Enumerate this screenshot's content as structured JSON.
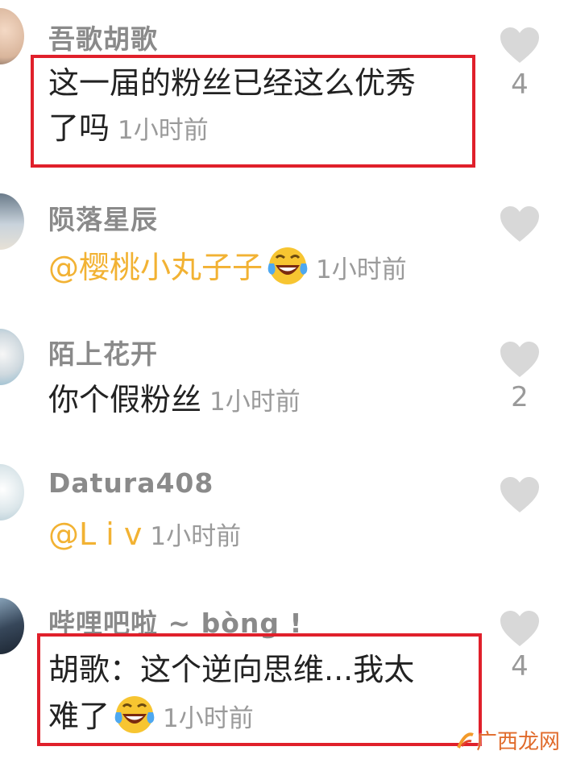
{
  "comments": [
    {
      "username": "吾歌胡歌",
      "lines": [
        "这一届的粉丝已经这么优秀",
        "了吗"
      ],
      "time": "1小时前",
      "likes": "4",
      "highlighted": true
    },
    {
      "username": "陨落星辰",
      "mention": "@樱桃小丸子子",
      "emoji": "laughing-crying",
      "time": "1小时前",
      "likes": ""
    },
    {
      "username": "陌上花开",
      "text": "你个假粉丝",
      "time": "1小时前",
      "likes": "2"
    },
    {
      "username": "Datura408",
      "mention": "@L i v",
      "time": "1小时前",
      "likes": ""
    },
    {
      "username": "哔哩吧啦 ~ bòng !",
      "lines": [
        "胡歌：这个逆向思维...我太",
        "难了"
      ],
      "emoji": "laughing-crying",
      "time": "1小时前",
      "likes": "4",
      "highlighted": true
    }
  ],
  "watermark": {
    "text": "广西龙网"
  },
  "colors": {
    "username": "#8a8a8a",
    "body_text": "#222222",
    "mention": "#f2b233",
    "timestamp": "#9a9a9a",
    "like_icon": "#d8d8d8",
    "highlight_border": "#e0202b"
  },
  "icons": [
    "heart-icon",
    "laughing-crying-emoji"
  ]
}
